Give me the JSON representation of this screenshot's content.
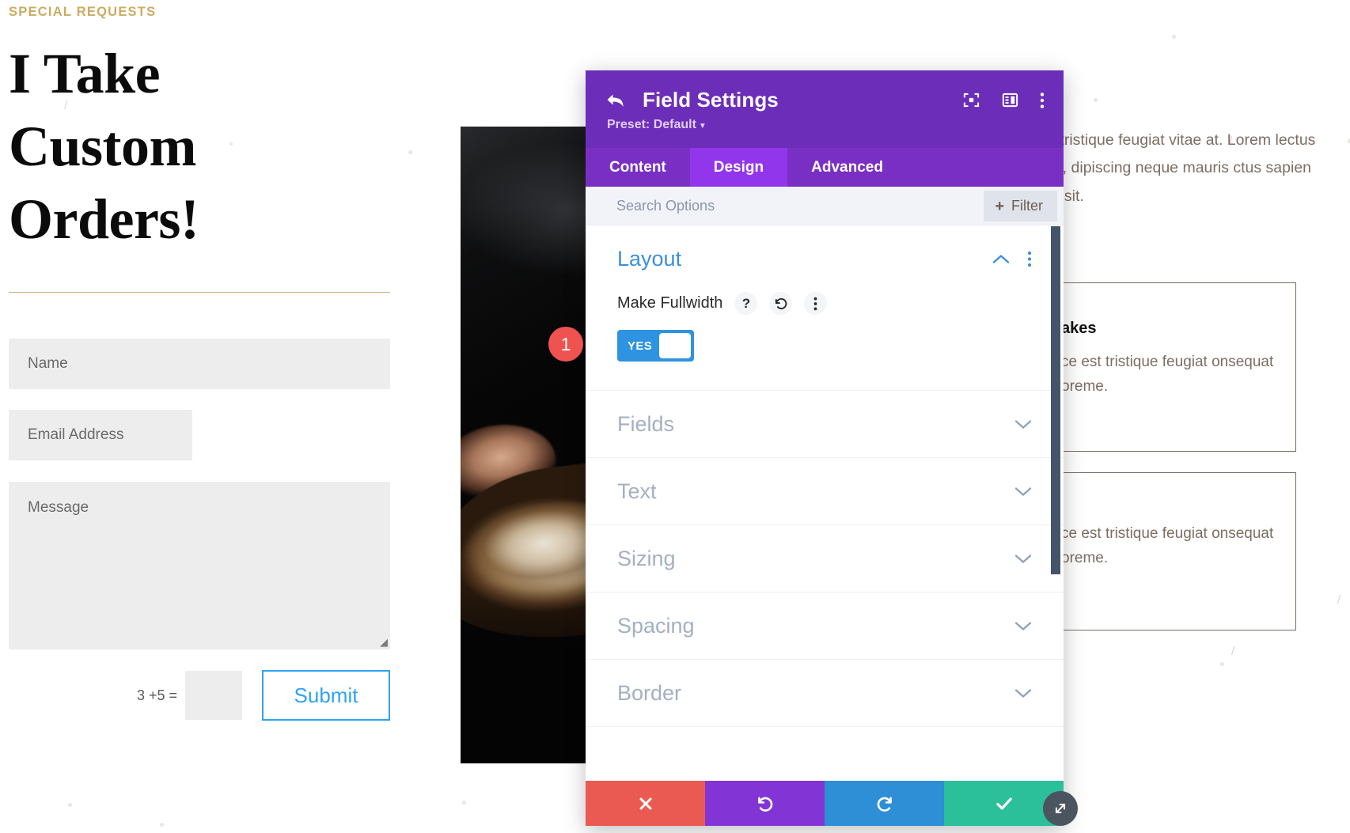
{
  "page": {
    "eyebrow": "SPECIAL REQUESTS",
    "heading": "I Take Custom Orders!",
    "form": {
      "name_placeholder": "Name",
      "email_placeholder": "Email Address",
      "message_placeholder": "Message",
      "captcha_question": "3 +5 =",
      "captcha_value": "",
      "submit_label": "Submit"
    },
    "right_text": {
      "paragraph": "est tristique feugiat vitae at. Lorem lectus felis, dipiscing neque mauris ctus sapien sed sit."
    },
    "cards": [
      {
        "title": "akes",
        "body": "ce est tristique feugiat onsequat oreme."
      },
      {
        "title": "",
        "body": "ce est tristique feugiat onsequat oreme."
      }
    ]
  },
  "modal": {
    "title": "Field Settings",
    "preset_label": "Preset: Default",
    "back_icon": "back-arrow-icon",
    "header_icons": [
      {
        "name": "focus-target-icon"
      },
      {
        "name": "layout-panel-icon"
      },
      {
        "name": "kebab-menu-icon"
      }
    ],
    "tabs": [
      {
        "label": "Content",
        "active": false
      },
      {
        "label": "Design",
        "active": true
      },
      {
        "label": "Advanced",
        "active": false
      }
    ],
    "search": {
      "placeholder": "Search Options",
      "filter_label": "Filter",
      "filter_plus": "+"
    },
    "sections": [
      {
        "label": "Layout",
        "open": true
      },
      {
        "label": "Fields",
        "open": false
      },
      {
        "label": "Text",
        "open": false
      },
      {
        "label": "Sizing",
        "open": false
      },
      {
        "label": "Spacing",
        "open": false
      },
      {
        "label": "Border",
        "open": false
      }
    ],
    "layout_control": {
      "label": "Make Fullwidth",
      "help_glyph": "?",
      "reset_icon": "undo-reset-icon",
      "more_icon": "kebab-menu-icon",
      "toggle_value": "YES"
    },
    "annotation_badge": "1",
    "footer": [
      {
        "name": "cancel-button",
        "glyph": "✖",
        "color": "#ea5a52"
      },
      {
        "name": "undo-button",
        "glyph": "↺",
        "color": "#8234d4"
      },
      {
        "name": "redo-button",
        "glyph": "↻",
        "color": "#2e8ed6"
      },
      {
        "name": "save-button",
        "glyph": "✔",
        "color": "#2bbf9a"
      }
    ],
    "colors": {
      "header_purple": "#6c2eb9",
      "tab_purple": "#7a2fc4",
      "tab_active_purple": "#9236ec",
      "accent_blue": "#3b8fe0",
      "toggle_blue": "#2e93e0",
      "badge_red": "#ef5350",
      "scrollbar": "#44546a"
    }
  }
}
